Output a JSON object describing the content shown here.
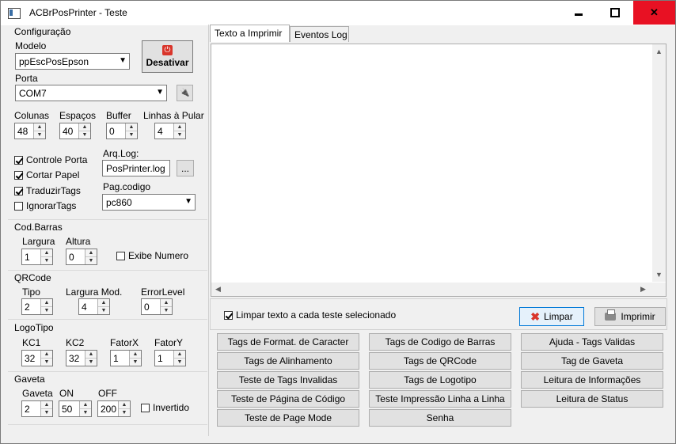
{
  "window": {
    "title": "ACBrPosPrinter - Teste",
    "controls": {
      "minimize": "minimize",
      "maximize": "maximize",
      "close": "close"
    }
  },
  "config": {
    "group_label": "Configuração",
    "modelo_label": "Modelo",
    "modelo_value": "ppEscPosEpson",
    "desativar_label": "Desativar",
    "porta_label": "Porta",
    "porta_value": "COM7",
    "colunas_label": "Colunas",
    "colunas_value": "48",
    "espacos_label": "Espaços",
    "espacos_value": "40",
    "buffer_label": "Buffer",
    "buffer_value": "0",
    "linhas_label": "Linhas à Pular",
    "linhas_value": "4",
    "checks": [
      {
        "label": "Controle Porta",
        "checked": true
      },
      {
        "label": "Cortar Papel",
        "checked": true
      },
      {
        "label": "TraduzirTags",
        "checked": true
      },
      {
        "label": "IgnorarTags",
        "checked": false
      }
    ],
    "arqlog_label": "Arq.Log:",
    "arqlog_value": "PosPrinter.log",
    "browse_label": "...",
    "pagcodigo_label": "Pag.codigo",
    "pagcodigo_value": "pc860"
  },
  "codbarras": {
    "group_label": "Cod.Barras",
    "largura_label": "Largura",
    "largura_value": "1",
    "altura_label": "Altura",
    "altura_value": "0",
    "exibe_label": "Exibe Numero",
    "exibe_checked": false
  },
  "qrcode": {
    "group_label": "QRCode",
    "tipo_label": "Tipo",
    "tipo_value": "2",
    "largura_label": "Largura Mod.",
    "largura_value": "4",
    "error_label": "ErrorLevel",
    "error_value": "0"
  },
  "logotipo": {
    "group_label": "LogoTipo",
    "kc1_label": "KC1",
    "kc1_value": "32",
    "kc2_label": "KC2",
    "kc2_value": "32",
    "fatorx_label": "FatorX",
    "fatorx_value": "1",
    "fatory_label": "FatorY",
    "fatory_value": "1"
  },
  "gaveta": {
    "group_label": "Gaveta",
    "gaveta_label": "Gaveta",
    "gaveta_value": "2",
    "on_label": "ON",
    "on_value": "50",
    "off_label": "OFF",
    "off_value": "200",
    "invertido_label": "Invertido",
    "invertido_checked": false
  },
  "tabs": [
    {
      "label": "Texto a Imprimir",
      "active": true
    },
    {
      "label": "Eventos Log",
      "active": false
    }
  ],
  "editor": {
    "content": ""
  },
  "actions": {
    "limpar_check_label": "Limpar texto a cada teste selecionado",
    "limpar_check_checked": true,
    "limpar_label": "Limpar",
    "imprimir_label": "Imprimir"
  },
  "grid_buttons": {
    "col1": [
      "Tags de Format. de Caracter",
      "Tags de Alinhamento",
      "Teste de Tags Invalidas",
      "Teste de Página de Código",
      "Teste de Page Mode"
    ],
    "col2": [
      "Tags de Codigo de Barras",
      "Tags de QRCode",
      "Tags de Logotipo",
      "Teste Impressão Linha a Linha",
      "Senha"
    ],
    "col3": [
      "Ajuda - Tags Validas",
      "Tag de Gaveta",
      "Leitura de Informações",
      "Leitura de Status"
    ]
  },
  "icons": {
    "power": "power-icon",
    "port_search": "port-search-icon",
    "clear": "clear-x-icon",
    "printer": "printer-icon"
  },
  "colors": {
    "close_button": "#e81123",
    "accent_red": "#d9352b",
    "focus_border": "#0078d7"
  }
}
